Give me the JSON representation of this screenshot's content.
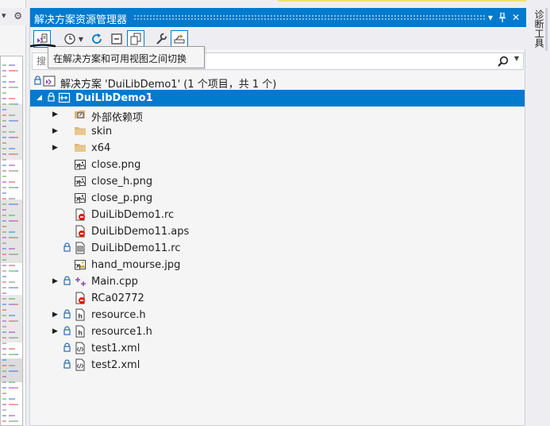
{
  "panel": {
    "title": "解决方案资源管理器",
    "title_buttons": {
      "dropdown": "▾",
      "pin": "ᛘ",
      "close": "✕"
    }
  },
  "tooltip": {
    "text": "在解决方案和可用视图之间切换"
  },
  "search": {
    "placeholder": "搜"
  },
  "right_tab": {
    "label": "诊断工具"
  },
  "tree": [
    {
      "label": "解决方案 'DuiLibDemo1' (1 个项目，共 1 个)",
      "icon": "solution-icon",
      "lock": true,
      "arrow": "",
      "indent": 0
    },
    {
      "label": "DuiLibDemo1",
      "icon": "project-icon",
      "lock": true,
      "arrow": "expanded",
      "indent": 1,
      "selected": true
    },
    {
      "label": "外部依赖项",
      "icon": "dependencies-icon",
      "lock": false,
      "arrow": "collapsed",
      "indent": 2
    },
    {
      "label": "skin",
      "icon": "folder-icon",
      "lock": false,
      "arrow": "collapsed",
      "indent": 2
    },
    {
      "label": "x64",
      "icon": "folder-icon",
      "lock": false,
      "arrow": "collapsed",
      "indent": 2
    },
    {
      "label": "close.png",
      "icon": "image-file-icon",
      "lock": false,
      "arrow": "",
      "indent": 2
    },
    {
      "label": "close_h.png",
      "icon": "image-file-icon",
      "lock": false,
      "arrow": "",
      "indent": 2
    },
    {
      "label": "close_p.png",
      "icon": "image-file-icon",
      "lock": false,
      "arrow": "",
      "indent": 2
    },
    {
      "label": "DuiLibDemo1.rc",
      "icon": "excluded-file-icon",
      "lock": false,
      "arrow": "",
      "indent": 2
    },
    {
      "label": "DuiLibDemo11.aps",
      "icon": "excluded-file-icon",
      "lock": false,
      "arrow": "",
      "indent": 2
    },
    {
      "label": "DuiLibDemo11.rc",
      "icon": "resource-file-icon",
      "lock": true,
      "arrow": "",
      "indent": 2
    },
    {
      "label": "hand_mourse.jpg",
      "icon": "jpg-file-icon",
      "lock": false,
      "arrow": "",
      "indent": 2
    },
    {
      "label": "Main.cpp",
      "icon": "cpp-file-icon",
      "lock": true,
      "arrow": "collapsed",
      "indent": 2
    },
    {
      "label": "RCa02772",
      "icon": "excluded-file-icon",
      "lock": false,
      "arrow": "",
      "indent": 2
    },
    {
      "label": "resource.h",
      "icon": "header-file-icon",
      "lock": true,
      "arrow": "collapsed",
      "indent": 2
    },
    {
      "label": "resource1.h",
      "icon": "header-file-icon",
      "lock": true,
      "arrow": "collapsed",
      "indent": 2
    },
    {
      "label": "test1.xml",
      "icon": "xml-file-icon",
      "lock": true,
      "arrow": "",
      "indent": 2
    },
    {
      "label": "test2.xml",
      "icon": "xml-file-icon",
      "lock": true,
      "arrow": "",
      "indent": 2
    }
  ],
  "colors": {
    "accent": "#007acc",
    "selected_text": "#ffffff",
    "folder": "#dcb67a",
    "excluded": "#e51400",
    "cpp": "#8a49a8"
  }
}
